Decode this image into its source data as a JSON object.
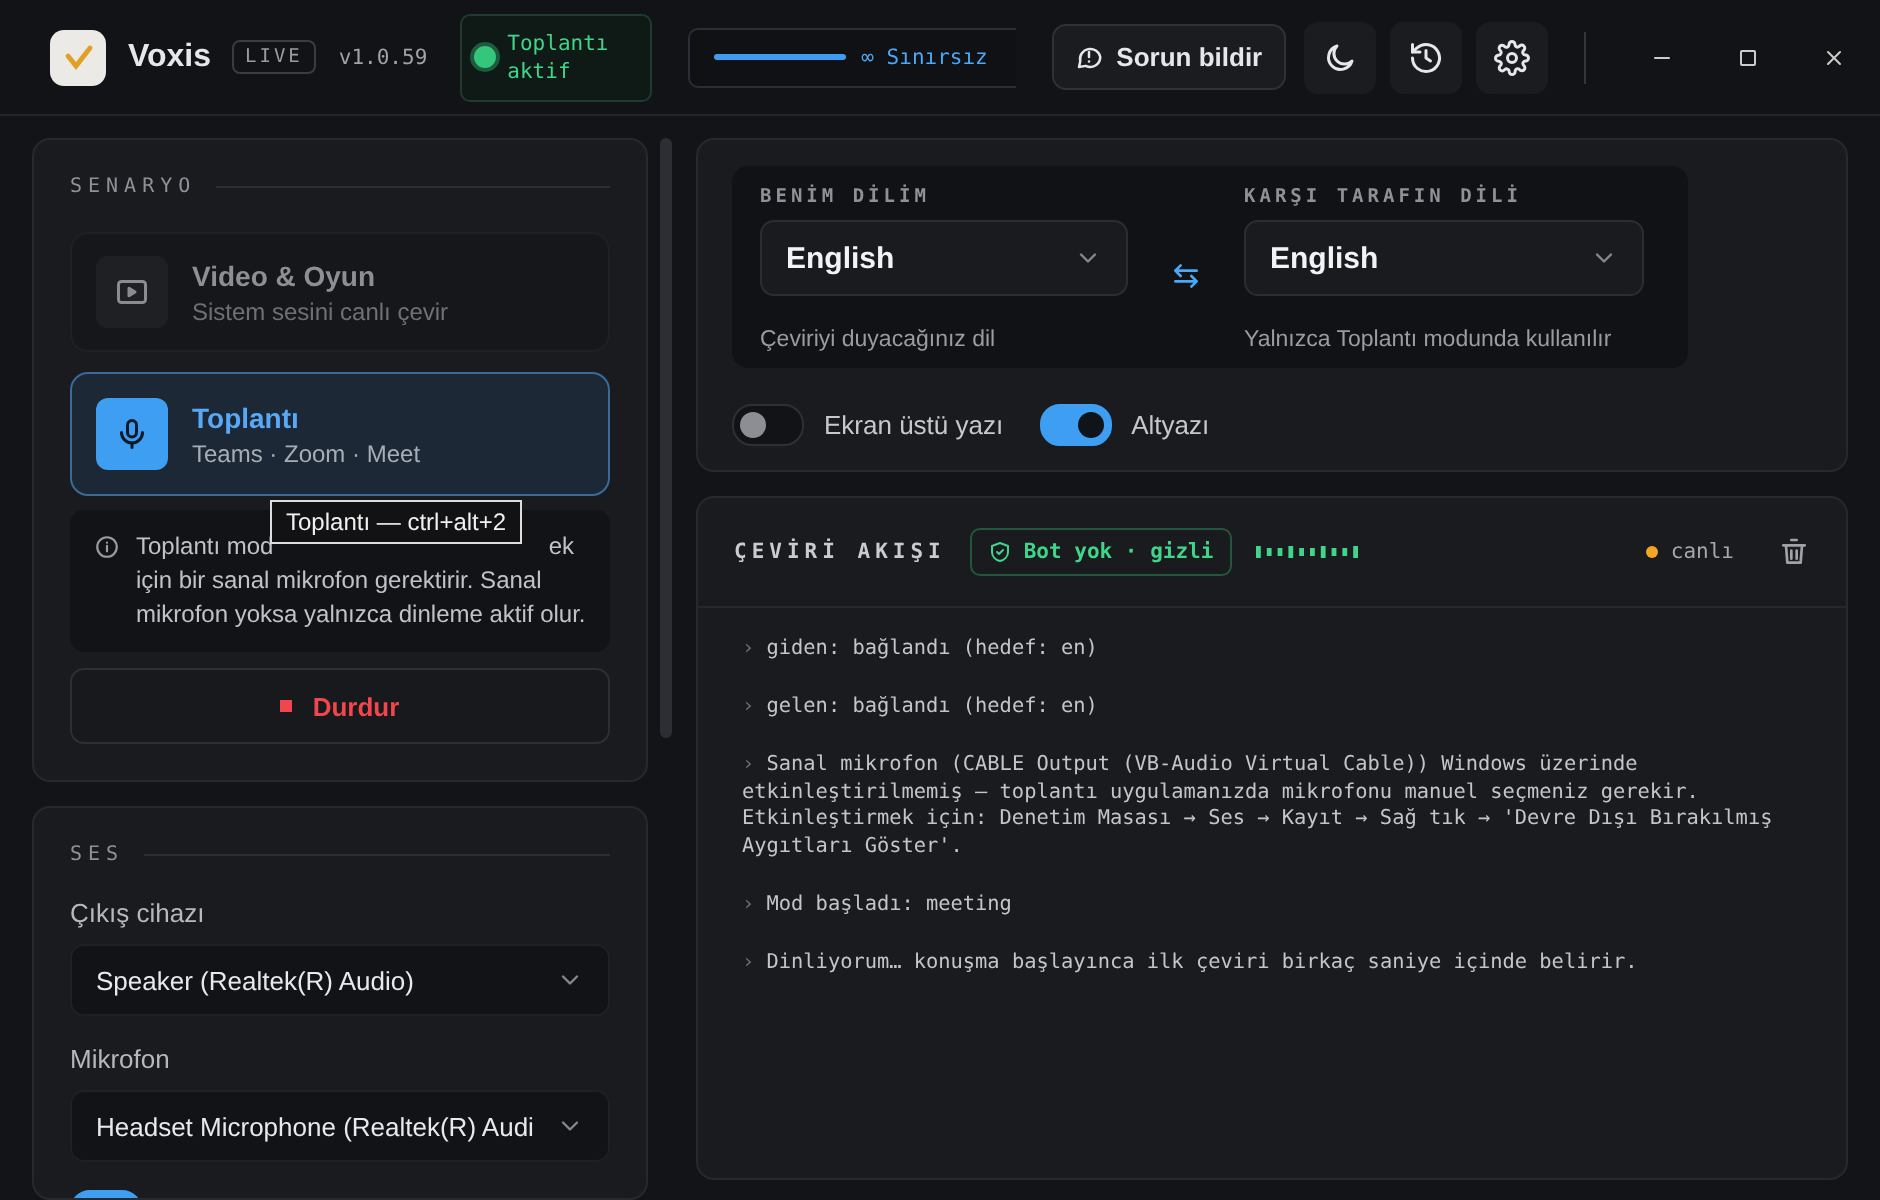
{
  "app": {
    "name": "Voxis",
    "badge": "LIVE",
    "version": "v1.0.59"
  },
  "meeting_status": {
    "label": "Toplantı aktif",
    "active": true
  },
  "usage": {
    "label": "∞ Sınırsız",
    "level": 1
  },
  "report_button": "Sorun bildir",
  "toolbar": [
    {
      "kind": "theme"
    },
    {
      "kind": "history"
    },
    {
      "kind": "settings"
    }
  ],
  "scenario": {
    "title": "SENARYO",
    "options": [
      {
        "kind": "video",
        "title": "Video & Oyun",
        "subtitle": "Sistem sesini canlı çevir",
        "selected": false
      },
      {
        "kind": "mic",
        "title": "Toplantı",
        "subtitle": "Teams · Zoom · Meet",
        "selected": true
      }
    ],
    "tooltip": "Toplantı — ctrl+alt+2",
    "info": {
      "first_line": [
        "Toplantı mod",
        "ek"
      ],
      "rest": "için bir sanal mikrofon gerektirir. Sanal mikrofon yoksa yalnızca dinleme aktif olur."
    },
    "stop_button": "Durdur"
  },
  "audio": {
    "title": "SES",
    "fields": [
      {
        "label": "Çıkış cihazı",
        "value": "Speaker (Realtek(R) Audio)"
      },
      {
        "label": "Mikrofon",
        "value": "Headset Microphone (Realtek(R) Audi"
      }
    ],
    "toggles": [
      {
        "on": true
      }
    ]
  },
  "languages": {
    "mine": {
      "label": "BENİM DİLİM",
      "value": "English",
      "hint": "Çeviriyi duyacağınız dil"
    },
    "theirs": {
      "label": "KARŞI TARAFIN DİLİ",
      "value": "English",
      "hint": "Yalnızca Toplantı modunda kullanılır"
    },
    "toggles": [
      {
        "label": "Ekran üstü yazı",
        "on": false
      },
      {
        "label": "Altyazı",
        "on": true
      }
    ]
  },
  "feed": {
    "title": "ÇEVİRİ AKIŞI",
    "badge": "Bot yok · gizli",
    "status": "canlı",
    "lines": [
      {
        "prefix": "›",
        "text": "giden: bağlandı (hedef: en)"
      },
      {
        "prefix": "›",
        "text": "gelen: bağlandı (hedef: en)"
      },
      {
        "prefix": "›",
        "text": "Sanal mikrofon (CABLE Output (VB-Audio Virtual Cable)) Windows üzerinde etkinleştirilmemiş — toplantı uygulamanızda mikrofonu manuel seçmeniz gerekir. Etkinleştirmek için: Denetim Masası → Ses → Kayıt → Sağ tık → 'Devre Dışı Bırakılmış Aygıtları Göster'."
      },
      {
        "prefix": "›",
        "text": "Mod başladı: meeting"
      },
      {
        "prefix": "›",
        "text": "Dinliyorum… konuşma başlayınca ilk çeviri birkaç saniye içinde belirir."
      }
    ]
  }
}
